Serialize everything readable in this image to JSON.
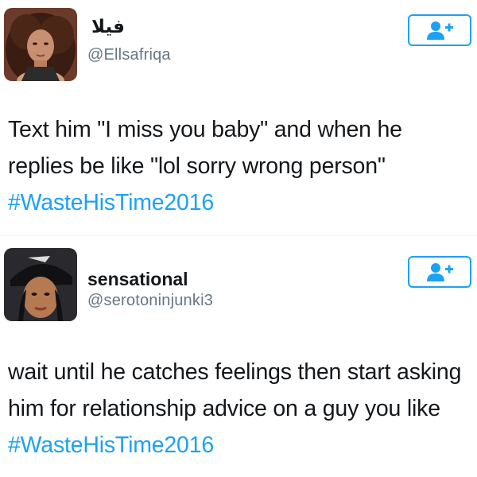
{
  "tweets": [
    {
      "display_name": "فيلا",
      "handle": "@Ellsafriqa",
      "text_before": "Text him \"I miss you baby\" and when he replies be like \"lol sorry wrong person\" ",
      "hashtag": "#WasteHisTime2016",
      "follow_icon": "add-user-icon"
    },
    {
      "display_name": "sensational",
      "handle": "@serotoninjunki3",
      "text_before": "wait until he catches feelings then start asking him for relationship advice on a guy you like ",
      "hashtag": "#WasteHisTime2016",
      "follow_icon": "add-user-icon"
    }
  ],
  "colors": {
    "accent": "#1da1f2",
    "text": "#14171a",
    "muted": "#657786"
  }
}
